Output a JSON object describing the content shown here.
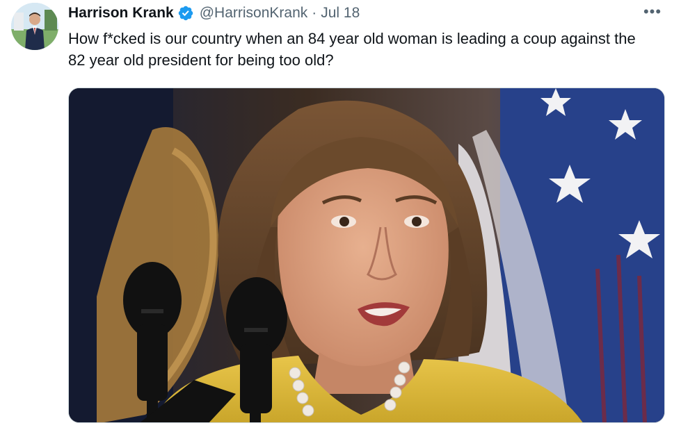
{
  "author": {
    "name": "Harrison Krank",
    "handle": "@HarrisonKrank",
    "separator": "·",
    "date": "Jul 18",
    "verified": true,
    "verified_color": "#1d9bf0"
  },
  "menu": {
    "more_label": "•••"
  },
  "tweet": {
    "text": "How f*cked is our country when an 84 year old woman is leading a coup against the 82 year old president for being too old?"
  },
  "icons": {
    "verified": "verified-badge-icon",
    "more": "more-options-icon"
  }
}
